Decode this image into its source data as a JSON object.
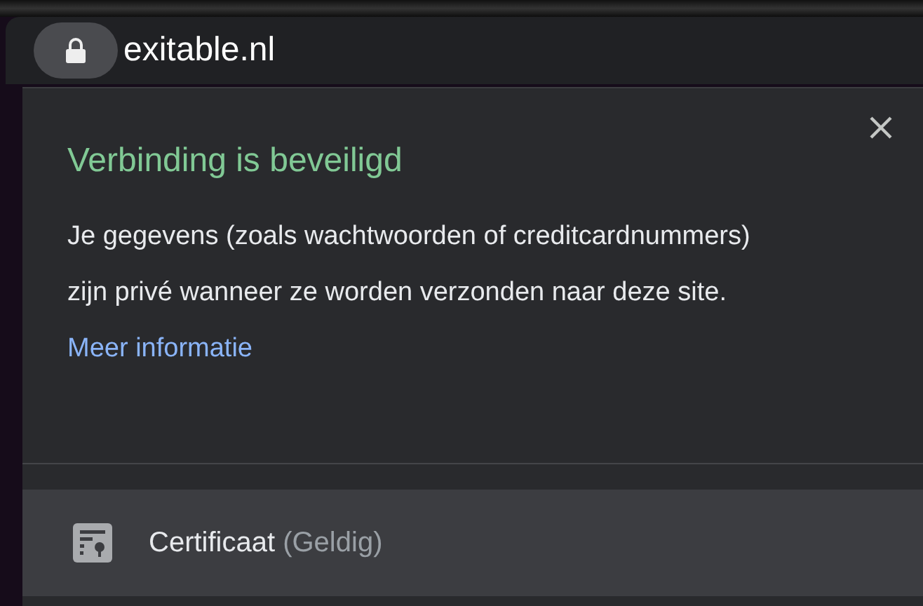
{
  "address_bar": {
    "url": "exitable.nl"
  },
  "popup": {
    "title": "Verbinding is beveiligd",
    "message": "Je gegevens (zoals wachtwoorden of creditcardnummers) zijn privé wanneer ze worden verzonden naar deze site.",
    "link": "Meer informatie",
    "items": [
      {
        "label": "Certificaat",
        "status": "(Geldig)"
      }
    ]
  }
}
